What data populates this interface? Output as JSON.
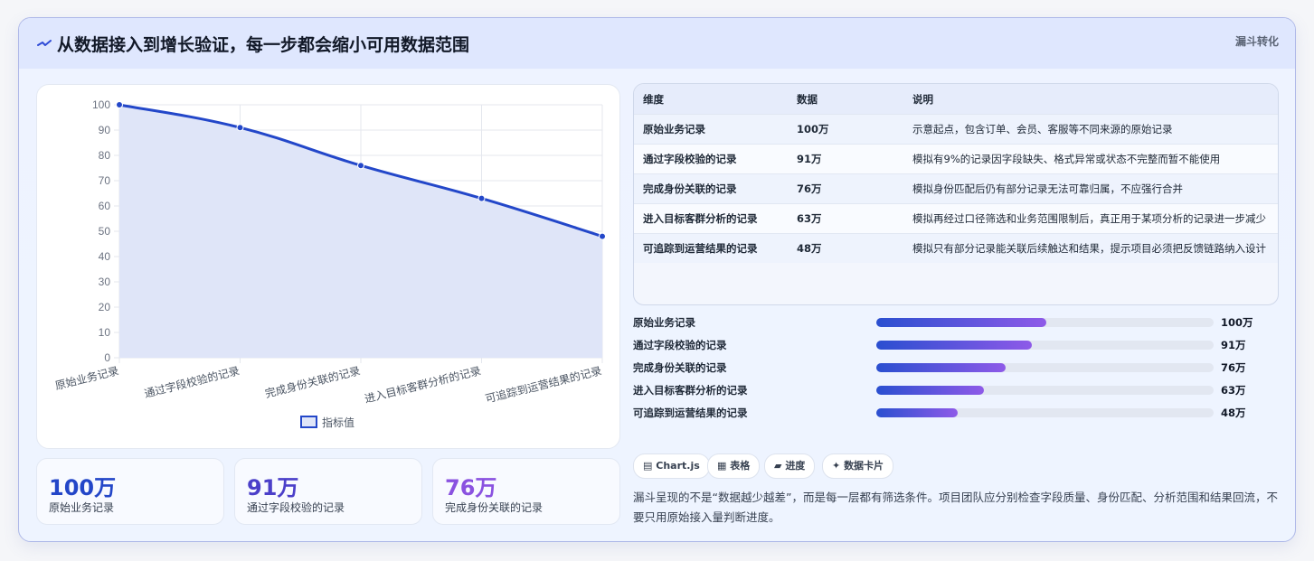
{
  "header": {
    "icon": "trend-down-icon",
    "title": "从数据接入到增长验证，每一步都会缩小可用数据范围",
    "tag": "漏斗转化"
  },
  "chart_data": {
    "type": "area",
    "categories": [
      "原始业务记录",
      "通过字段校验的记录",
      "完成身份关联的记录",
      "进入目标客群分析的记录",
      "可追踪到运营结果的记录"
    ],
    "series": [
      {
        "name": "指标值",
        "values": [
          100,
          91,
          76,
          63,
          48
        ]
      }
    ],
    "ylim": [
      0,
      100
    ],
    "yticks": [
      0,
      10,
      20,
      30,
      40,
      50,
      60,
      70,
      80,
      90,
      100
    ],
    "grid": true,
    "legend": "bottom",
    "line_color": "#2347c9",
    "fill_color": "#dfe5f8"
  },
  "stats": [
    {
      "value": "100万",
      "label": "原始业务记录",
      "color": "#2346c8"
    },
    {
      "value": "91万",
      "label": "通过字段校验的记录",
      "color": "#4b3fc9"
    },
    {
      "value": "76万",
      "label": "完成身份关联的记录",
      "color": "#8a52e0"
    }
  ],
  "table": {
    "headers": [
      "维度",
      "数据",
      "说明"
    ],
    "rows": [
      {
        "dim": "原始业务记录",
        "val": "100万",
        "desc": "示意起点，包含订单、会员、客服等不同来源的原始记录"
      },
      {
        "dim": "通过字段校验的记录",
        "val": "91万",
        "desc": "模拟有9%的记录因字段缺失、格式异常或状态不完整而暂不能使用"
      },
      {
        "dim": "完成身份关联的记录",
        "val": "76万",
        "desc": "模拟身份匹配后仍有部分记录无法可靠归属，不应强行合并"
      },
      {
        "dim": "进入目标客群分析的记录",
        "val": "63万",
        "desc": "模拟再经过口径筛选和业务范围限制后，真正用于某项分析的记录进一步减少"
      },
      {
        "dim": "可追踪到运营结果的记录",
        "val": "48万",
        "desc": "模拟只有部分记录能关联后续触达和结果，提示项目必须把反馈链路纳入设计"
      }
    ]
  },
  "progress": [
    {
      "label": "原始业务记录",
      "value": "100万",
      "fraction": 0.505
    },
    {
      "label": "通过字段校验的记录",
      "value": "91万",
      "fraction": 0.46
    },
    {
      "label": "完成身份关联的记录",
      "value": "76万",
      "fraction": 0.383
    },
    {
      "label": "进入目标客群分析的记录",
      "value": "63万",
      "fraction": 0.318
    },
    {
      "label": "可追踪到运营结果的记录",
      "value": "48万",
      "fraction": 0.242
    }
  ],
  "chips": [
    {
      "label": "Chart.js",
      "icon": "chart-icon",
      "glyph": "▤"
    },
    {
      "label": "表格",
      "icon": "table-icon",
      "glyph": "▦"
    },
    {
      "label": "进度",
      "icon": "progress-icon",
      "glyph": "▰"
    },
    {
      "label": "数据卡片",
      "icon": "sparkle-icon",
      "glyph": "✦"
    }
  ],
  "summary": "漏斗呈现的不是“数据越少越差”，而是每一层都有筛选条件。项目团队应分别检查字段质量、身份匹配、分析范围和结果回流，不要只用原始接入量判断进度。"
}
